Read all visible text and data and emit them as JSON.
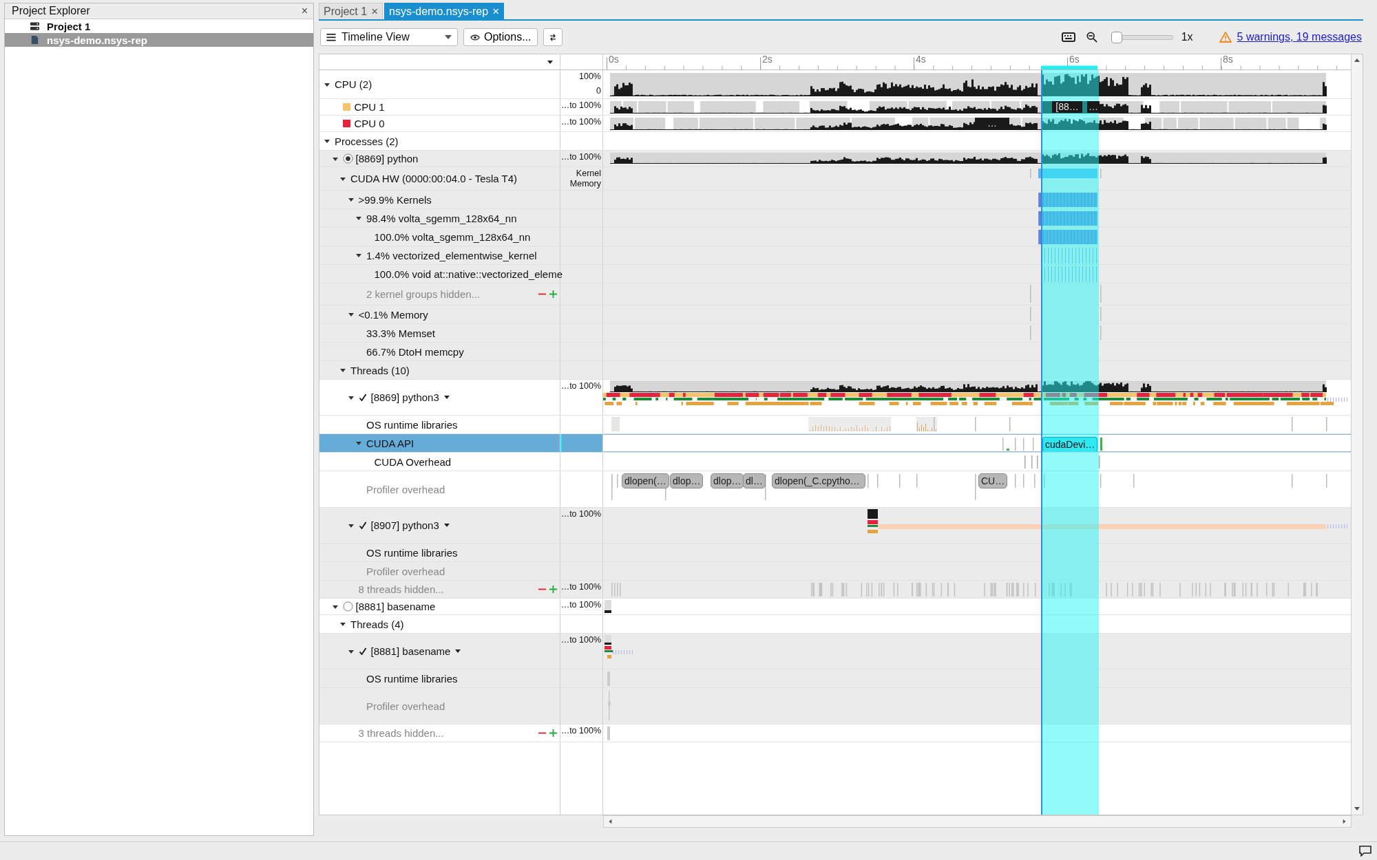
{
  "project_explorer": {
    "title": "Project Explorer",
    "close": "×",
    "items": [
      {
        "label": "Project 1",
        "kind": "project",
        "selected": false
      },
      {
        "label": "nsys-demo.nsys-rep",
        "kind": "report",
        "selected": true
      }
    ]
  },
  "tabs": [
    {
      "label": "Project 1",
      "close": "×",
      "selected": false
    },
    {
      "label": "nsys-demo.nsys-rep",
      "close": "×",
      "selected": true
    }
  ],
  "toolbar": {
    "view": "Timeline View",
    "options": "Options...",
    "zoom": {
      "level": 0.0
    },
    "zoom_label": "1x",
    "warnings": "5 warnings, 19 messages"
  },
  "ruler": {
    "ticks": [
      "0s",
      "2s",
      "4s",
      "6s",
      "8s"
    ]
  },
  "rows": [
    {
      "label": "CPU (2)",
      "kind": "group",
      "expanded": true,
      "selected": false,
      "shaded": false,
      "scale": [
        "100%",
        "0"
      ],
      "track": {
        "kind": "cpu-total"
      },
      "children": [
        {
          "label": "CPU 1",
          "kind": "cpu",
          "color": "#f7c46c",
          "selected": false,
          "shaded": false,
          "scale": [
            "…to 100%"
          ],
          "track": {
            "kind": "cpu-core-a"
          },
          "chips": [
            {
              "text": "[88…",
              "kind": "overlay"
            },
            {
              "text": "…",
              "kind": "overlay"
            }
          ]
        },
        {
          "label": "CPU 0",
          "kind": "cpu",
          "color": "#e8223c",
          "selected": false,
          "shaded": false,
          "scale": [
            "…to 100%"
          ],
          "track": {
            "kind": "cpu-core-b"
          },
          "chips": [
            {
              "text": "…",
              "kind": "overlay"
            }
          ]
        }
      ]
    },
    {
      "label": "Processes (2)",
      "kind": "group",
      "expanded": true,
      "selected": false,
      "shaded": false,
      "children": [
        {
          "label": "[8869] python",
          "kind": "process",
          "radio_on": true,
          "expanded": true,
          "selected": false,
          "shaded": true,
          "scale": [
            "…to 100%"
          ],
          "track": {
            "kind": "cpu-process"
          },
          "children": [
            {
              "label": "CUDA HW (0000:00:04.0 - Tesla T4)",
              "kind": "group",
              "expanded": true,
              "selected": false,
              "shaded": true,
              "scale": [
                "Kernel",
                "Memory"
              ],
              "track": {
                "kind": "gpu-summary"
              },
              "children": [
                {
                  "label": ">99.9% Kernels",
                  "kind": "group",
                  "expanded": true,
                  "selected": false,
                  "shaded": true,
                  "track": {
                    "kind": "kernels"
                  },
                  "children": [
                    {
                      "label": "98.4% volta_sgemm_128x64_nn",
                      "kind": "group",
                      "expanded": true,
                      "selected": false,
                      "shaded": true,
                      "track": {
                        "kind": "kernels"
                      },
                      "children": [
                        {
                          "label": "100.0% volta_sgemm_128x64_nn",
                          "kind": "track",
                          "selected": false,
                          "shaded": true,
                          "track": {
                            "kind": "kernels"
                          }
                        }
                      ]
                    },
                    {
                      "label": "1.4% vectorized_elementwise_kernel",
                      "kind": "group",
                      "expanded": true,
                      "selected": false,
                      "shaded": true,
                      "track": {
                        "kind": "kernel-ticks"
                      },
                      "children": [
                        {
                          "label": "100.0% void at::native::vectorized_eleme",
                          "kind": "track",
                          "selected": false,
                          "shaded": true,
                          "track": {
                            "kind": "kernel-ticks"
                          }
                        }
                      ]
                    },
                    {
                      "label": "2 kernel groups hidden...",
                      "kind": "hidden",
                      "selected": false,
                      "shaded": true,
                      "track": {
                        "kind": "mem"
                      }
                    }
                  ]
                },
                {
                  "label": "<0.1% Memory",
                  "kind": "group",
                  "expanded": true,
                  "selected": false,
                  "shaded": true,
                  "track": {
                    "kind": "mem"
                  },
                  "children": [
                    {
                      "label": "33.3% Memset",
                      "kind": "track",
                      "selected": false,
                      "shaded": true,
                      "track": {
                        "kind": "mem"
                      }
                    },
                    {
                      "label": "66.7% DtoH memcpy",
                      "kind": "track",
                      "selected": false,
                      "shaded": true
                    }
                  ]
                }
              ]
            },
            {
              "label": "Threads (10)",
              "kind": "group",
              "expanded": true,
              "selected": false,
              "shaded": true,
              "children": [
                {
                  "label": "[8869] python3",
                  "kind": "thread",
                  "checked": true,
                  "expanded": true,
                  "selected": false,
                  "shaded": false,
                  "scale": [
                    "…to 100%"
                  ],
                  "track": {
                    "kind": "thread"
                  },
                  "children": [
                    {
                      "label": "OS runtime libraries",
                      "kind": "track",
                      "selected": false,
                      "shaded": false,
                      "track": {
                        "kind": "os"
                      }
                    },
                    {
                      "label": "CUDA API",
                      "kind": "track",
                      "expanded": true,
                      "selected": true,
                      "shaded": false,
                      "track": {
                        "kind": "api"
                      },
                      "chips": [
                        {
                          "text": "cudaDevi…",
                          "kind": "call"
                        }
                      ],
                      "children": [
                        {
                          "label": "CUDA Overhead",
                          "kind": "track",
                          "selected": false,
                          "shaded": false,
                          "track": {
                            "kind": "overhead"
                          }
                        }
                      ]
                    },
                    {
                      "label": "Profiler overhead",
                      "kind": "muted",
                      "selected": false,
                      "shaded": false,
                      "track": {
                        "kind": "ranges"
                      },
                      "chips": [
                        {
                          "text": "dlopen(…",
                          "kind": "range"
                        },
                        {
                          "text": "dlop…",
                          "kind": "range"
                        },
                        {
                          "text": "dlop…",
                          "kind": "range"
                        },
                        {
                          "text": "dl…",
                          "kind": "range"
                        },
                        {
                          "text": "dlopen(_C.cpytho…",
                          "kind": "range"
                        },
                        {
                          "text": "CU…",
                          "kind": "range"
                        }
                      ]
                    }
                  ]
                },
                {
                  "label": "[8907] python3",
                  "kind": "thread",
                  "checked": true,
                  "expanded": true,
                  "selected": false,
                  "shaded": true,
                  "scale": [
                    "…to 100%"
                  ],
                  "track": {
                    "kind": "thread-late"
                  },
                  "children": [
                    {
                      "label": "OS runtime libraries",
                      "kind": "track",
                      "selected": false,
                      "shaded": true
                    },
                    {
                      "label": "Profiler overhead",
                      "kind": "muted",
                      "selected": false,
                      "shaded": true
                    }
                  ]
                },
                {
                  "label": "8 threads hidden...",
                  "kind": "hidden",
                  "selected": false,
                  "shaded": true,
                  "scale": [
                    "…to 100%"
                  ],
                  "track": {
                    "kind": "ticks"
                  }
                }
              ]
            }
          ]
        },
        {
          "label": "[8881] basename",
          "kind": "process",
          "radio_on": false,
          "expanded": true,
          "selected": false,
          "shaded": false,
          "scale": [
            "…to 100%"
          ],
          "track": {
            "kind": "cpu-early"
          },
          "children": [
            {
              "label": "Threads (4)",
              "kind": "group",
              "expanded": true,
              "selected": false,
              "shaded": false,
              "children": [
                {
                  "label": "[8881] basename",
                  "kind": "thread",
                  "checked": true,
                  "expanded": true,
                  "selected": false,
                  "shaded": true,
                  "scale": [
                    "…to 100%"
                  ],
                  "track": {
                    "kind": "thread-early"
                  },
                  "children": [
                    {
                      "label": "OS runtime libraries",
                      "kind": "track",
                      "selected": false,
                      "shaded": true,
                      "track": {
                        "kind": "ticks-early"
                      }
                    },
                    {
                      "label": "Profiler overhead",
                      "kind": "muted",
                      "selected": false,
                      "shaded": true,
                      "track": {
                        "kind": "ticks-tall"
                      }
                    }
                  ]
                },
                {
                  "label": "3 threads hidden...",
                  "kind": "hidden",
                  "selected": false,
                  "shaded": false,
                  "scale": [
                    "…to 100%"
                  ],
                  "track": {
                    "kind": "ticks-early"
                  }
                }
              ]
            }
          ]
        }
      ]
    }
  ]
}
